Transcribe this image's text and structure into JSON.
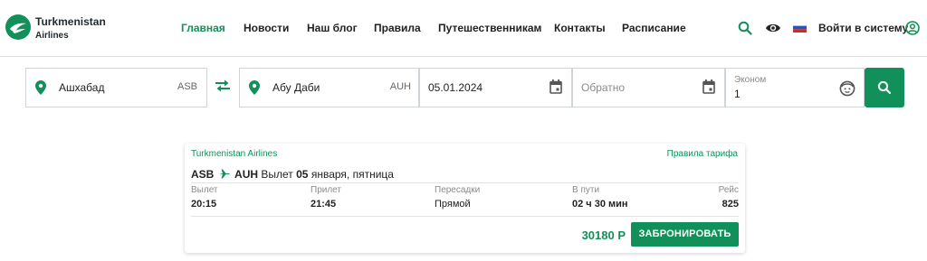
{
  "header": {
    "brand": {
      "name": "Turkmenistan",
      "sub": "Airlines"
    },
    "nav": [
      {
        "label": "Главная",
        "active": true
      },
      {
        "label": "Новости"
      },
      {
        "label": "Наш блог"
      },
      {
        "label": "Правила"
      },
      {
        "label": "Путешественникам"
      },
      {
        "label": "Контакты"
      },
      {
        "label": "Расписание"
      }
    ],
    "login_label": "Войти в систему",
    "icons": [
      "search-icon",
      "eye-icon",
      "russian-flag-icon",
      "user-icon"
    ]
  },
  "search": {
    "from": {
      "city": "Ашхабад",
      "code": "ASB"
    },
    "to": {
      "city": "Абу Даби",
      "code": "AUH"
    },
    "depart_date": "05.01.2024",
    "return_placeholder": "Обратно",
    "cabin": {
      "label": "Эконом",
      "passengers": "1"
    }
  },
  "result": {
    "airline": "Turkmenistan Airlines",
    "fare_rules": "Правила тарифа",
    "route": {
      "from": "ASB",
      "to": "AUH",
      "departure_prefix": "Вылет",
      "date_day": "05",
      "date_rest": "января, пятница"
    },
    "columns": {
      "depart": {
        "label": "Вылет",
        "value": "20:15"
      },
      "arrive": {
        "label": "Прилет",
        "value": "21:45"
      },
      "stops": {
        "label": "Пересадки",
        "value": "Прямой"
      },
      "duration": {
        "label": "В пути",
        "value": "02 ч 30 мин"
      },
      "flight": {
        "label": "Рейс",
        "value": "825"
      }
    },
    "price": "30180 Р",
    "book_label": "ЗАБРОНИРОВАТЬ"
  },
  "colors": {
    "brand_green": "#12905a",
    "text": "#222222",
    "muted": "#8a8a8a"
  }
}
